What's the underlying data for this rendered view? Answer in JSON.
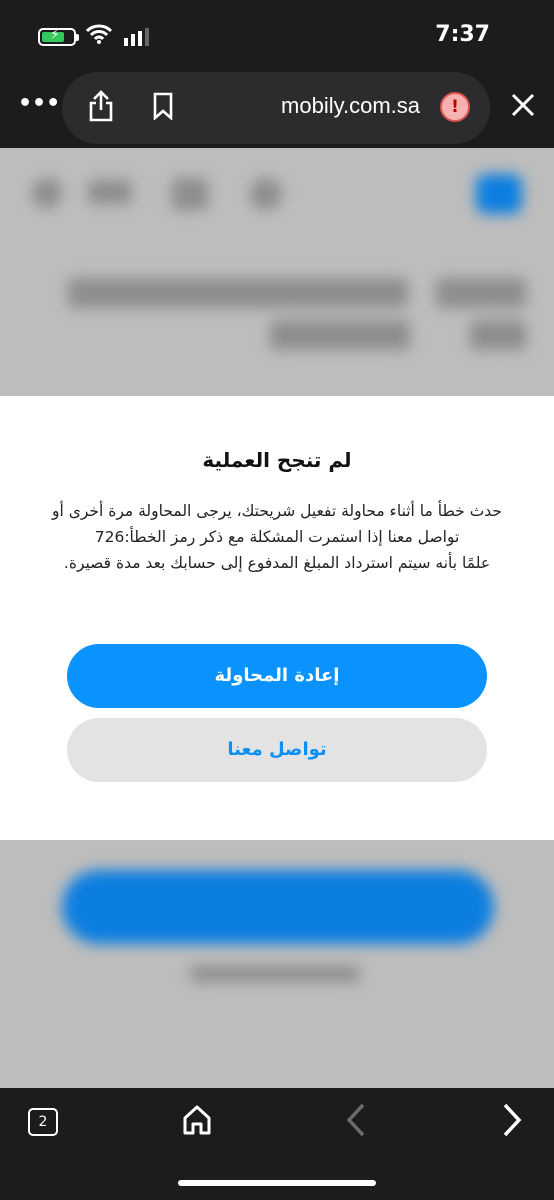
{
  "status": {
    "time": "7:37"
  },
  "browser": {
    "domain": "mobily.com.sa",
    "open_tabs": "2"
  },
  "modal": {
    "title": "لم تنجح العملية",
    "message_lines": [
      "حدث خطأ ما أثناء محاولة تفعيل شريحتك، يرجى المحاولة مرة أخرى أو",
      "تواصل معنا إذا استمرت المشكلة مع ذكر رمز الخطأ:726",
      "علمًا بأنه سيتم استرداد المبلغ المدفوع إلى حسابك بعد مدة قصيرة."
    ],
    "retry_label": "إعادة المحاولة",
    "contact_label": "تواصل معنا"
  },
  "colors": {
    "primary": "#0a92ff",
    "secondary_bg": "#e3e3e3",
    "warning": "#f6b1b1"
  }
}
